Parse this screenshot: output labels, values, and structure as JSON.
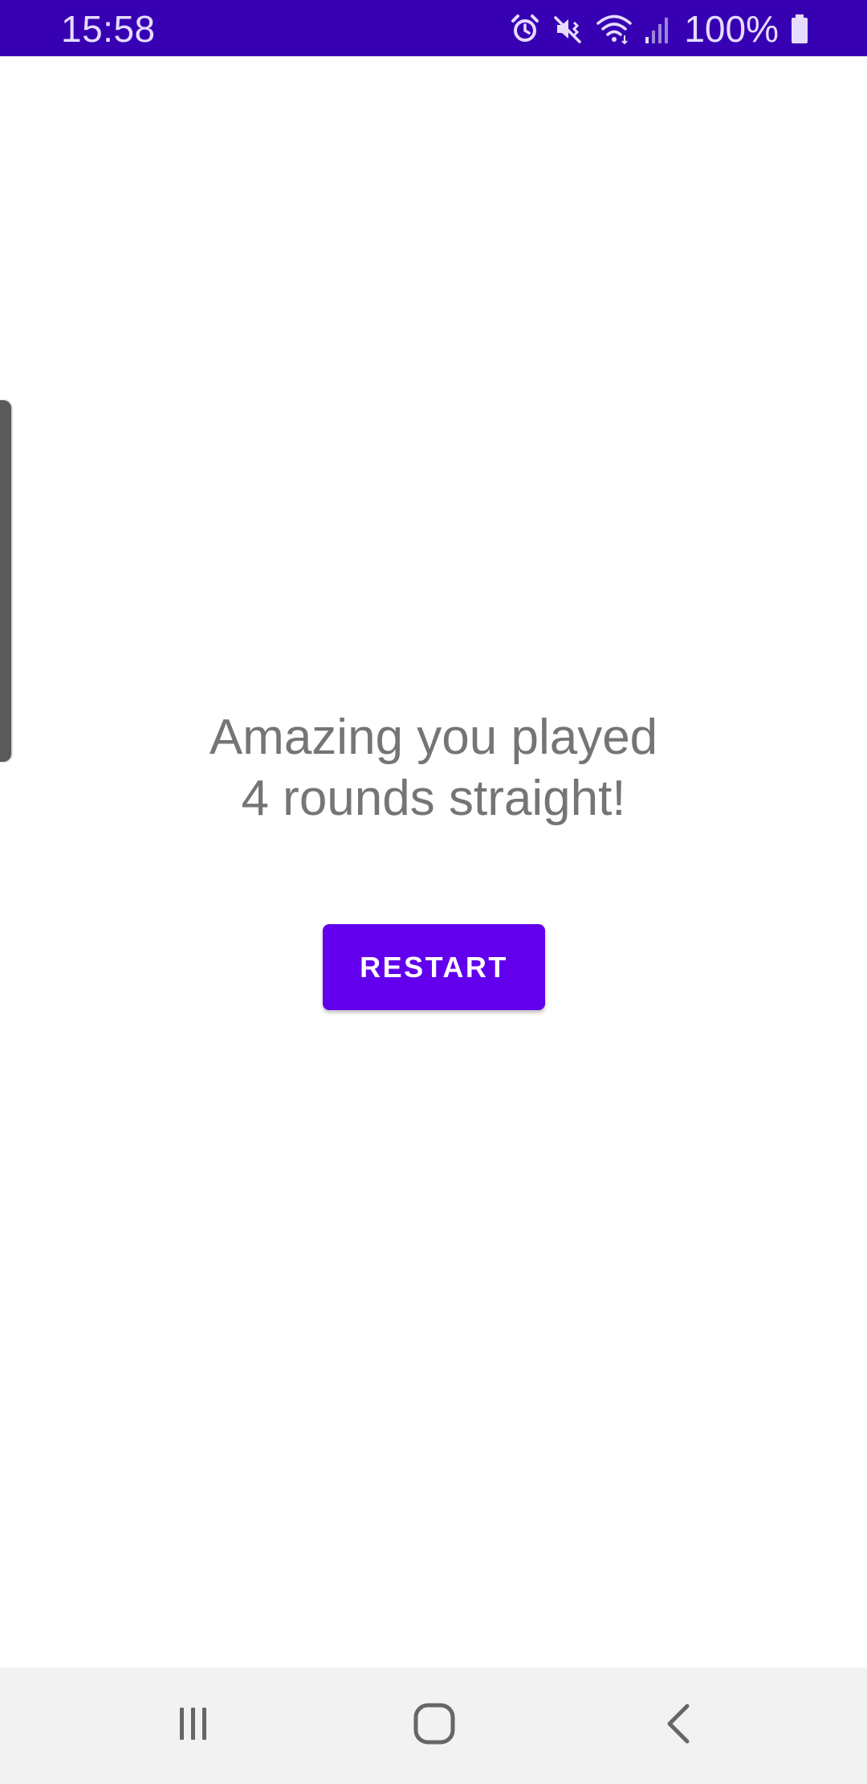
{
  "status_bar": {
    "time": "15:58",
    "battery_percent": "100%",
    "icons": [
      "alarm-icon",
      "mute-vibrate-icon",
      "wifi-icon",
      "signal-icon",
      "battery-icon"
    ],
    "background_color": "#3700b3"
  },
  "main": {
    "message_line1": "Amazing you played",
    "message_line2": "4 rounds straight!",
    "restart_label": "RESTART",
    "accent_color": "#6200ee"
  },
  "nav_bar": {
    "buttons": [
      "recents-icon",
      "home-icon",
      "back-icon"
    ]
  }
}
